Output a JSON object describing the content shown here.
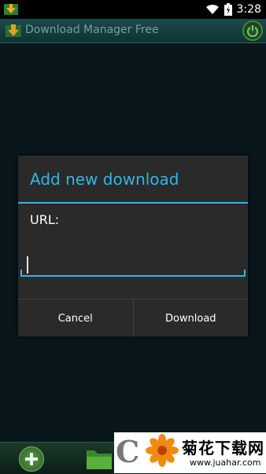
{
  "status_bar": {
    "time": "3:28",
    "icons": [
      "download-app-icon",
      "wifi-icon",
      "battery-icon"
    ]
  },
  "app_bar": {
    "title": "Download Manager Free",
    "icons": [
      "app-logo-icon",
      "power-icon"
    ]
  },
  "dialog": {
    "title": "Add new download",
    "url_label": "URL:",
    "url_input": {
      "value": "",
      "placeholder": ""
    },
    "cancel_label": "Cancel",
    "download_label": "Download"
  },
  "bottom_bar": {
    "icons": [
      "add-icon",
      "folder-icon"
    ]
  },
  "watermark": {
    "title": "菊花下载网",
    "url": "www.juahar.com"
  },
  "colors": {
    "accent": "#33b5e5",
    "dialog_bg": "#2a2a2a",
    "app_bar_text": "#6fa0a0"
  }
}
